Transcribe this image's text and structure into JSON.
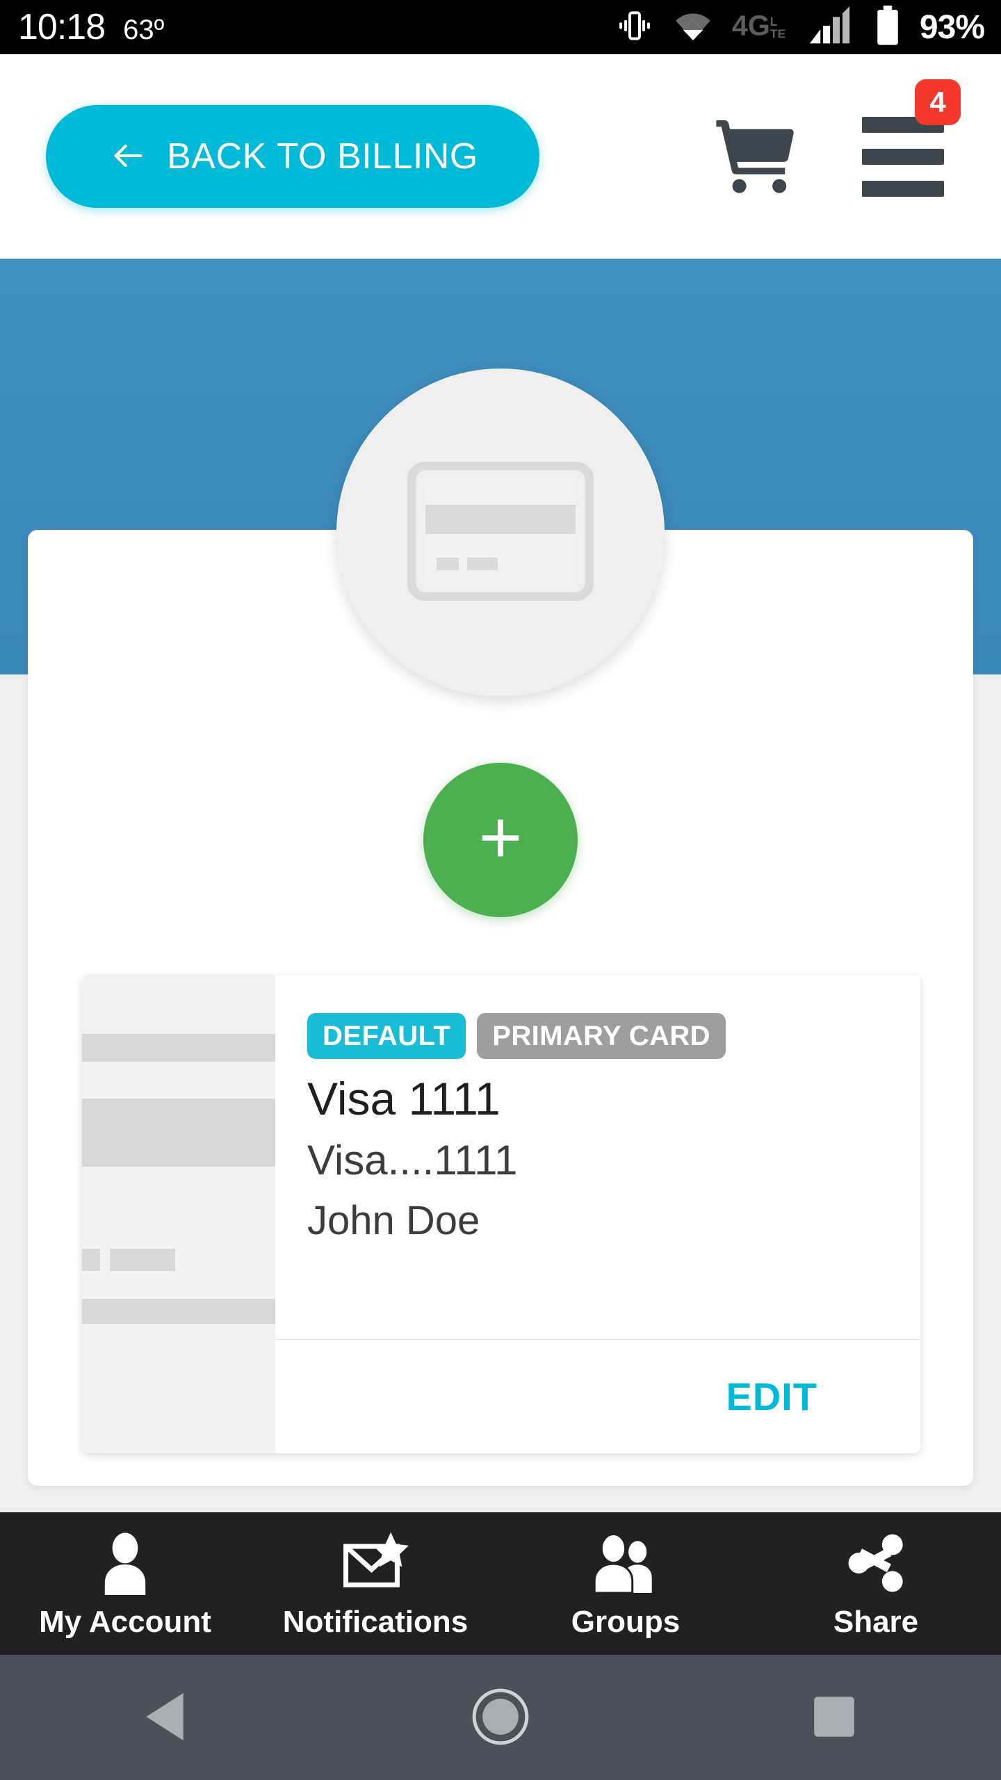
{
  "statusbar": {
    "time": "10:18",
    "temperature": "63º",
    "battery_percent": "93%",
    "icons": [
      "vibrate-icon",
      "wifi-icon",
      "4g-lte-icon",
      "signal-icon",
      "battery-icon"
    ],
    "network_label": "4G",
    "network_sub": "LTE"
  },
  "header": {
    "back_button_label": "BACK TO BILLING",
    "cart_icon": "shopping-cart-icon",
    "menu_icon": "hamburger-menu-icon",
    "menu_badge_count": "4"
  },
  "hero": {
    "avatar_icon": "credit-card-icon"
  },
  "content": {
    "add_button_label": "+",
    "add_button_color": "#4caf50"
  },
  "payment_method": {
    "badges": [
      {
        "label": "DEFAULT",
        "color": "#18bcd4"
      },
      {
        "label": "PRIMARY CARD",
        "color": "#9e9e9e"
      }
    ],
    "title": "Visa 1111",
    "subtitle": "Visa....1111",
    "cardholder": "John Doe",
    "edit_label": "EDIT",
    "edit_color": "#00b9d6",
    "thumbnail_icon": "credit-card-thumbnail"
  },
  "tabbar": {
    "items": [
      {
        "label": "My Account",
        "icon": "person-icon"
      },
      {
        "label": "Notifications",
        "icon": "envelope-star-icon"
      },
      {
        "label": "Groups",
        "icon": "people-group-icon"
      },
      {
        "label": "Share",
        "icon": "share-nodes-icon"
      }
    ]
  },
  "navbar": {
    "items": [
      {
        "label": "Back",
        "icon": "back-triangle-icon"
      },
      {
        "label": "Home",
        "icon": "home-circle-icon"
      },
      {
        "label": "Recents",
        "icon": "recents-square-icon"
      }
    ]
  },
  "theme": {
    "accent_cyan": "#00b9d6",
    "hero_blue": "#3d8cbd",
    "page_gray": "#eeeeee",
    "tabbar_dark": "#212121",
    "navbar_slate": "#4a5158",
    "badge_red": "#f4392c"
  }
}
